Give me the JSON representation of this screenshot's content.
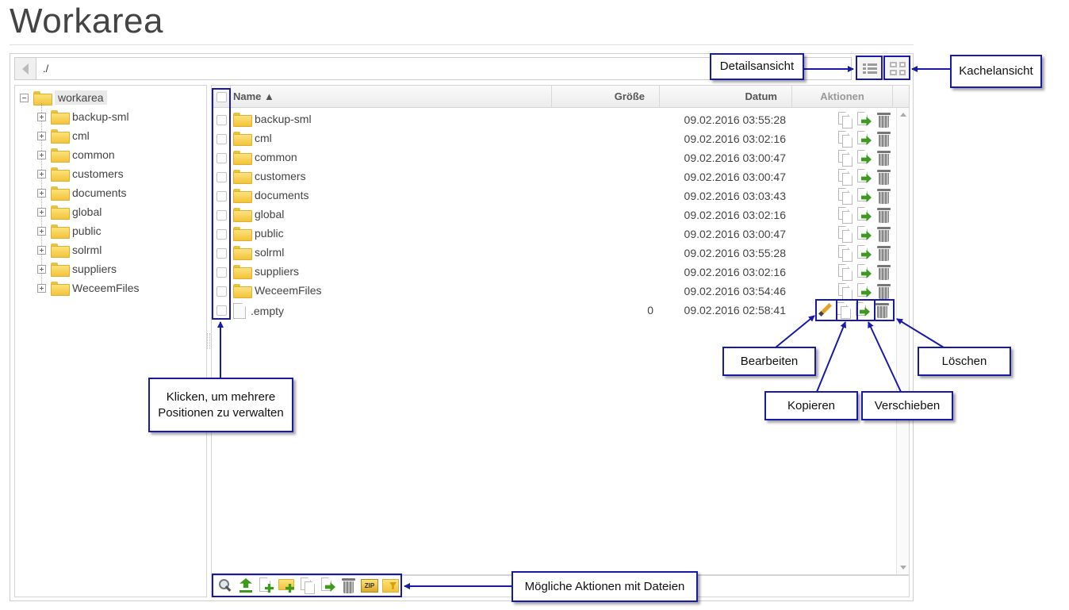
{
  "page": {
    "title": "Workarea"
  },
  "toolbar": {
    "path": "./"
  },
  "tree": {
    "root": "workarea",
    "items": [
      "backup-sml",
      "cml",
      "common",
      "customers",
      "documents",
      "global",
      "public",
      "solrml",
      "suppliers",
      "WeceemFiles"
    ]
  },
  "list": {
    "columns": {
      "name": "Name ▲",
      "size": "Größe",
      "date": "Datum",
      "actions": "Aktionen"
    },
    "rows": [
      {
        "name": "backup-sml",
        "size": "",
        "date": "09.02.2016 03:55:28",
        "type": "folder"
      },
      {
        "name": "cml",
        "size": "",
        "date": "09.02.2016 03:02:16",
        "type": "folder"
      },
      {
        "name": "common",
        "size": "",
        "date": "09.02.2016 03:00:47",
        "type": "folder"
      },
      {
        "name": "customers",
        "size": "",
        "date": "09.02.2016 03:00:47",
        "type": "folder"
      },
      {
        "name": "documents",
        "size": "",
        "date": "09.02.2016 03:03:43",
        "type": "folder"
      },
      {
        "name": "global",
        "size": "",
        "date": "09.02.2016 03:02:16",
        "type": "folder"
      },
      {
        "name": "public",
        "size": "",
        "date": "09.02.2016 03:00:47",
        "type": "folder"
      },
      {
        "name": "solrml",
        "size": "",
        "date": "09.02.2016 03:55:28",
        "type": "folder"
      },
      {
        "name": "suppliers",
        "size": "",
        "date": "09.02.2016 03:02:16",
        "type": "folder"
      },
      {
        "name": "WeceemFiles",
        "size": "",
        "date": "09.02.2016 03:54:46",
        "type": "folder"
      },
      {
        "name": ".empty",
        "size": "0",
        "date": "09.02.2016 02:58:41",
        "type": "file"
      }
    ]
  },
  "bottom_tools": [
    "search-icon",
    "upload-icon",
    "new-file-icon",
    "new-folder-icon",
    "copy-icon",
    "move-icon",
    "trash-icon",
    "zip-icon",
    "unzip-icon"
  ],
  "callouts": {
    "details_view": "Detailsansicht",
    "tiles_view": "Kachelansicht",
    "edit": "Bearbeiten",
    "delete": "Löschen",
    "copy": "Kopieren",
    "move": "Verschieben",
    "multi_select_1": "Klicken, um mehrere",
    "multi_select_2": "Positionen zu verwalten",
    "file_actions": "Mögliche Aktionen mit Dateien"
  },
  "colors": {
    "callout_border": "#1a1aaa",
    "folder": "#f2c33b",
    "move_arrow": "#3d9a1e"
  }
}
